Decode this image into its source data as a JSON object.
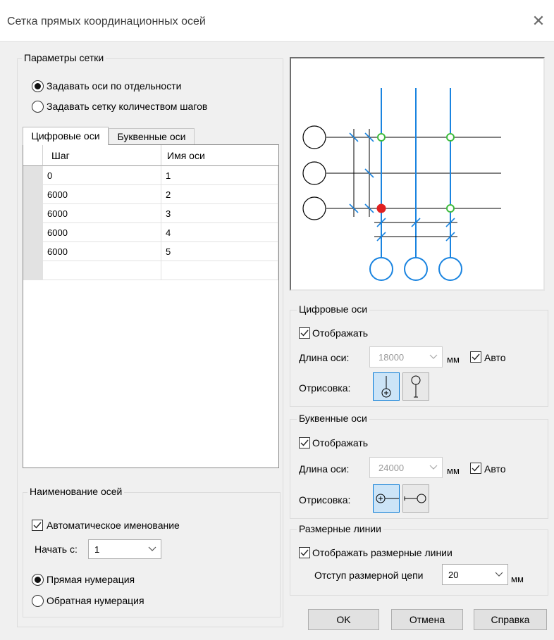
{
  "window": {
    "title": "Сетка прямых координационных осей",
    "close_symbol": "✕"
  },
  "grid_params": {
    "group_label": "Параметры сетки",
    "radio_separately": "Задавать оси по отдельности",
    "radio_by_steps": "Задавать сетку количеством шагов",
    "selected": "separately"
  },
  "tabs": [
    {
      "label": "Цифровые оси",
      "active": true
    },
    {
      "label": "Буквенные оси",
      "active": false
    }
  ],
  "table": {
    "columns": [
      "Шаг",
      "Имя оси"
    ],
    "rows": [
      {
        "step": "0",
        "name": "1"
      },
      {
        "step": "6000",
        "name": "2"
      },
      {
        "step": "6000",
        "name": "3"
      },
      {
        "step": "6000",
        "name": "4"
      },
      {
        "step": "6000",
        "name": "5"
      }
    ]
  },
  "naming": {
    "group_label": "Наименование осей",
    "auto_label": "Автоматическое именование",
    "auto_checked": true,
    "start_label": "Начать с:",
    "start_value": "1",
    "radio_forward": "Прямая нумерация",
    "radio_reverse": "Обратная нумерация",
    "selected": "forward"
  },
  "digit_axes": {
    "group_label": "Цифровые оси",
    "show_label": "Отображать",
    "show_checked": true,
    "length_label": "Длина оси:",
    "length_value": "18000",
    "unit": "мм",
    "auto_label": "Авто",
    "auto_checked": true,
    "draw_label": "Отрисовка:"
  },
  "letter_axes": {
    "group_label": "Буквенные оси",
    "show_label": "Отображать",
    "show_checked": true,
    "length_label": "Длина оси:",
    "length_value": "24000",
    "unit": "мм",
    "auto_label": "Авто",
    "auto_checked": true,
    "draw_label": "Отрисовка:"
  },
  "dim_lines": {
    "group_label": "Размерные линии",
    "show_label": "Отображать размерные линии",
    "show_checked": true,
    "offset_label": "Отступ размерной цепи",
    "offset_value": "20",
    "unit": "мм"
  },
  "buttons": {
    "ok": "OK",
    "cancel": "Отмена",
    "help": "Справка"
  },
  "colors": {
    "axis_blue": "#1a84e0",
    "node_green": "#3dbb3d",
    "node_red": "#e02020",
    "selected_bg": "#cce4f7",
    "selected_border": "#0078d7"
  }
}
